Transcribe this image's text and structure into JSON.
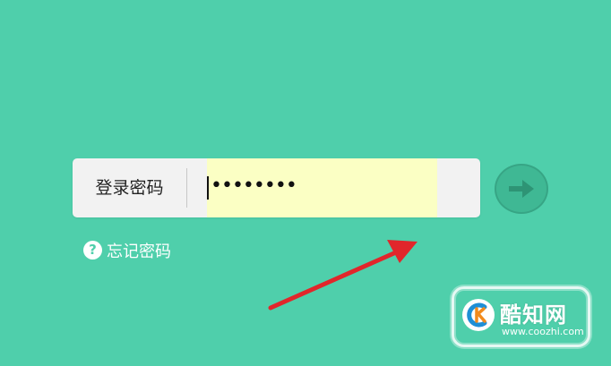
{
  "login": {
    "label": "登录密码",
    "password_mask": "••••••••",
    "forgot_label": "忘记密码",
    "help_glyph": "?"
  },
  "watermark": {
    "name": "酷知网",
    "url": "www.coozhi.com"
  },
  "icons": {
    "submit": "arrow-right-icon",
    "help": "question-circle-icon",
    "annotation": "red-pointer-arrow"
  },
  "colors": {
    "background": "#4fcfab",
    "field_highlight": "#fbffc4",
    "submit_circle": "#3fb894",
    "annotation_arrow": "#e1262b"
  }
}
